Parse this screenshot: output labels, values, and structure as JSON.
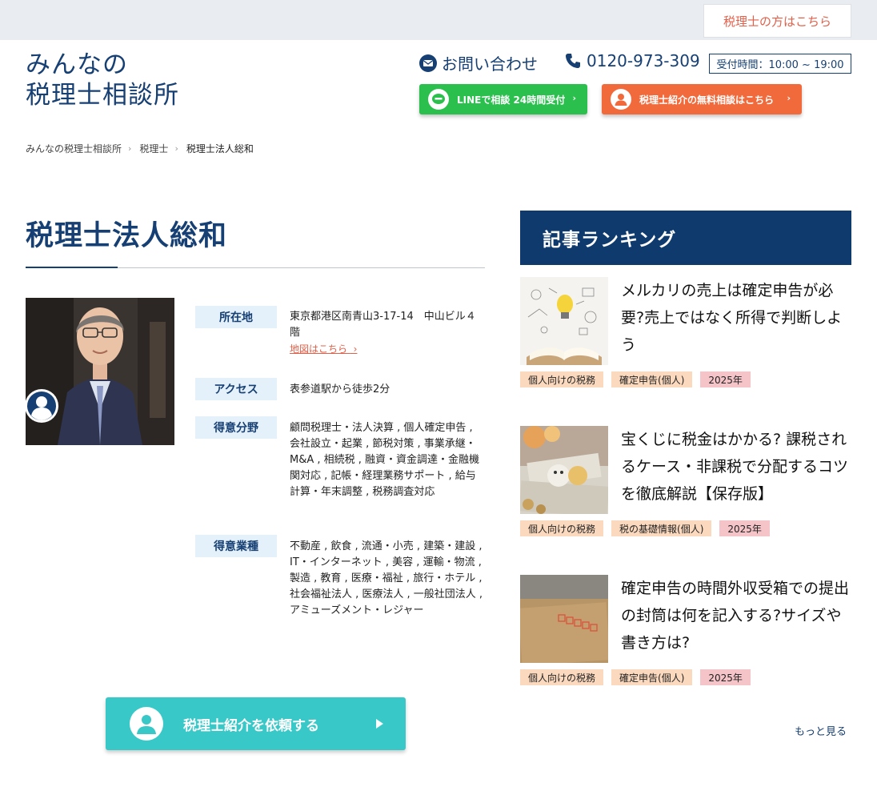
{
  "header": {
    "pro_link": "税理士の方はこちら",
    "logo_line1": "みんなの",
    "logo_line2": "税理士相談所",
    "inquiry_label": "お問い合わせ",
    "phone": "0120-973-309",
    "hours": "受付時間：10:00 ~ 19:00",
    "line_cta": "LINEで相談 24時間受付",
    "free_cta": "税理士紹介の無料相談はこちら",
    "colors": {
      "navy": "#163f73",
      "line_green": "#2bbf4e",
      "orange": "#f16a3c",
      "teal": "#38c8c8"
    }
  },
  "breadcrumb": [
    "みんなの税理士相談所",
    "税理士",
    "税理士法人総和"
  ],
  "profile": {
    "title": "税理士法人総和",
    "rows": [
      {
        "label": "所在地",
        "value": "東京都港区南青山3-17-14　中山ビル４階",
        "link": "地図はこちら"
      },
      {
        "label": "アクセス",
        "value": "表参道駅から徒歩2分"
      },
      {
        "label": "得意分野",
        "value": "顧問税理士・法人決算 , 個人確定申告 , 会社設立・起業 , 節税対策 , 事業承継・M&A , 相続税 , 融資・資金調達・金融機関対応 , 記帳・経理業務サポート , 給与計算・年末調整 , 税務調査対応"
      },
      {
        "label": "得意業種",
        "value": "不動産 , 飲食 , 流通・小売 , 建築・建設 , IT・インターネット , 美容 , 運輸・物流 , 製造 , 教育 , 医療・福祉 , 旅行・ホテル , 社会福祉法人 , 医療法人 , 一般社団法人 , アミューズメント・レジャー"
      }
    ],
    "request_button": "税理士紹介を依頼する"
  },
  "ranking": {
    "heading": "記事ランキング",
    "articles": [
      {
        "title": "メルカリの売上は確定申告が必要?売上ではなく所得で判断しよう",
        "tags": [
          "個人向けの税務",
          "確定申告(個人)",
          "2025年"
        ]
      },
      {
        "title": "宝くじに税金はかかる? 課税されるケース・非課税で分配するコツを徹底解説【保存版】",
        "tags": [
          "個人向けの税務",
          "税の基礎情報(個人)",
          "2025年"
        ]
      },
      {
        "title": "確定申告の時間外収受箱での提出の封筒は何を記入する?サイズや書き方は?",
        "tags": [
          "個人向けの税務",
          "確定申告(個人)",
          "2025年"
        ]
      }
    ],
    "more": "もっと見る"
  }
}
